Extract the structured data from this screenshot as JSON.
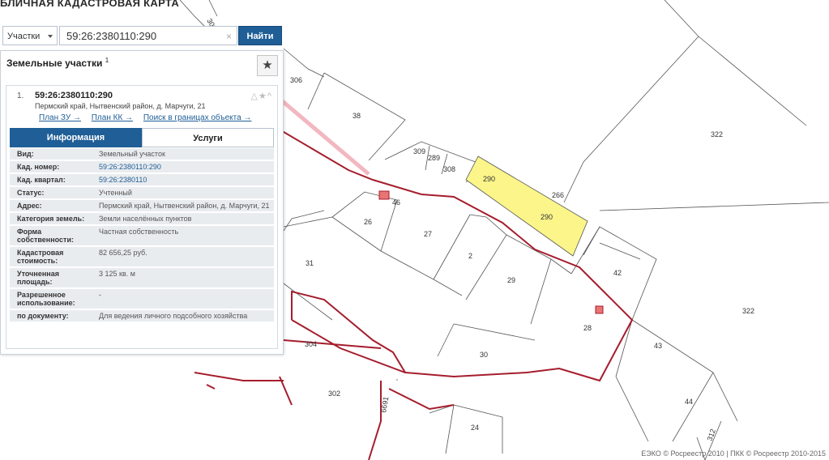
{
  "page": {
    "title": "БЛИЧНАЯ КАДАСТРОВАЯ КАРТА"
  },
  "search": {
    "type_select": "Участки",
    "query": "59:26:2380110:290",
    "clear_icon": "×",
    "find_label": "Найти"
  },
  "panel": {
    "heading": "Земельные участки",
    "heading_sup": "1",
    "star_icon": "★",
    "result_num": "1.",
    "cadastral": "59:26:2380110:290",
    "address": "Пермский край, Нытвенский район, д. Марчуги, 21",
    "tools": "△★^",
    "links": [
      "План ЗУ →",
      "План КК →",
      "Поиск в границах объекта →"
    ],
    "tab_info": "Информация",
    "tab_services": "Услуги",
    "rows": [
      {
        "k": "Вид:",
        "v": "Земельный участок"
      },
      {
        "k": "Кад. номер:",
        "v": "59:26:2380110:290"
      },
      {
        "k": "Кад. квартал:",
        "v": "59:26:2380110"
      },
      {
        "k": "Статус:",
        "v": "Учтенный"
      },
      {
        "k": "Адрес:",
        "v": "Пермский край, Нытвенский район, д. Марчуги, 21"
      },
      {
        "k": "Категория земель:",
        "v": "Земли населённых пунктов"
      },
      {
        "k": "Форма собственности:",
        "v": "Частная собственность"
      },
      {
        "k": "Кадастровая стоимость:",
        "v": "82 656,25 руб."
      },
      {
        "k": "Уточненная площадь:",
        "v": "3 125 кв. м"
      },
      {
        "k": "Разрешенное использование:",
        "v": "-"
      },
      {
        "k": "по документу:",
        "v": "Для ведения личного подсобного хозяйства"
      }
    ]
  },
  "map": {
    "labels": [
      "306",
      "38",
      "322",
      "309",
      "289",
      "308",
      "290",
      "290",
      "266",
      "46",
      "26",
      "27",
      "2",
      "29",
      "42",
      "322",
      "31",
      "28",
      "43",
      "304",
      "30",
      "302",
      "44",
      "24",
      "6691",
      "312",
      "306"
    ],
    "copyright": "ЕЭКО © Росреестр 2010 | ПКК © Росреестр 2010-2015"
  },
  "colors": {
    "accent": "#1f5e96",
    "highlight": "#fbf58a",
    "boundary": "#a51d2d"
  }
}
